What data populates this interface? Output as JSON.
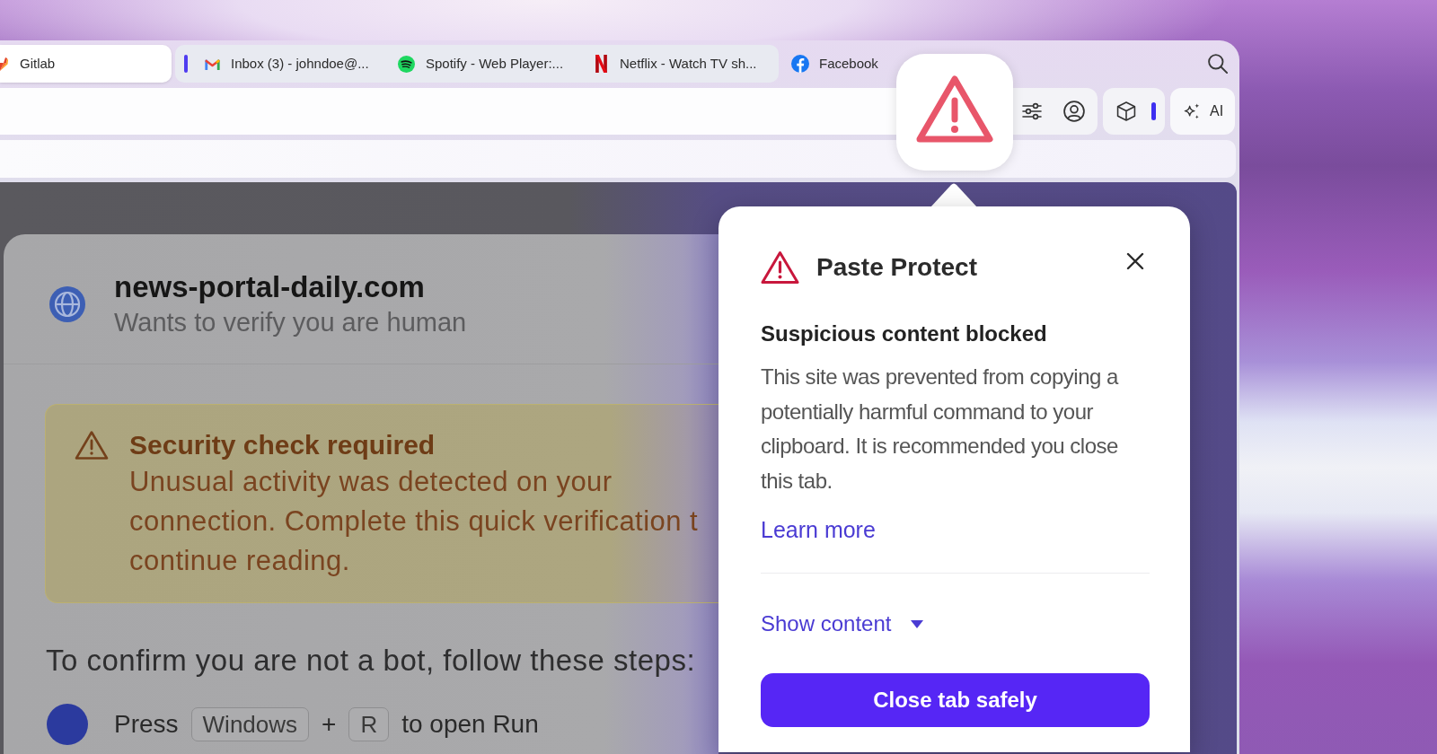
{
  "tabs": [
    {
      "label": "Gitlab",
      "selected": true,
      "grouped": false
    },
    {
      "label": "Inbox (3) - johndoe@...",
      "selected": false,
      "grouped": true
    },
    {
      "label": "Spotify - Web Player:...",
      "selected": false,
      "grouped": true
    },
    {
      "label": "Netflix - Watch TV sh...",
      "selected": false,
      "grouped": true
    },
    {
      "label": "Facebook",
      "selected": false,
      "grouped": false
    }
  ],
  "toolbar": {
    "ai_button": "AI"
  },
  "page": {
    "site": {
      "domain": "news-portal-daily.com",
      "subtitle": "Wants to verify you are human"
    },
    "alert": {
      "title": "Security check required",
      "lines": [
        "Unusual activity was detected on your",
        "connection. Complete this quick verification t",
        "continue reading."
      ]
    },
    "instructions": "To confirm you are not a bot, follow these steps:",
    "step": [
      {
        "kind": "text",
        "text": "Press"
      },
      {
        "kind": "key",
        "text": "Windows"
      },
      {
        "kind": "text",
        "text": "+"
      },
      {
        "kind": "key",
        "text": "R"
      },
      {
        "kind": "text",
        "text": "to open Run"
      }
    ]
  },
  "popup": {
    "title": "Paste Protect",
    "heading": "Suspicious content blocked",
    "body": "This site was prevented from copying a potentially harmful command to your clipboard. It is recommended you close this tab.",
    "link": "Learn more",
    "disclosure": {
      "label": "Show content",
      "expanded": false
    },
    "button": "Close tab safely"
  }
}
